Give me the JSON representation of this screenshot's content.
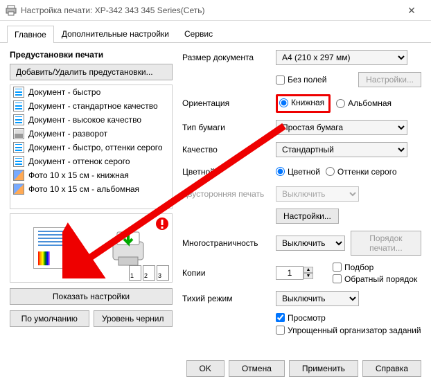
{
  "window": {
    "title": "Настройка печати: XP-342 343 345 Series(Сеть)"
  },
  "tabs": {
    "main": "Главное",
    "additional": "Дополнительные настройки",
    "service": "Сервис"
  },
  "left": {
    "sectionTitle": "Предустановки печати",
    "addRemoveBtn": "Добавить/Удалить предустановки...",
    "presets": [
      "Документ - быстро",
      "Документ - стандартное качество",
      "Документ - высокое качество",
      "Документ - разворот",
      "Документ - быстро, оттенки серого",
      "Документ - оттенок серого",
      "Фото 10 x 15 см - книжная",
      "Фото 10 x 15 см - альбомная"
    ],
    "showSettings": "Показать настройки",
    "defaultBtn": "По умолчанию",
    "inkLevels": "Уровень чернил"
  },
  "right": {
    "docSizeLabel": "Размер документа",
    "docSize": "A4 (210 x 297 мм)",
    "borderlessLabel": "Без полей",
    "settingsBtn": "Настройки...",
    "orientationLabel": "Ориентация",
    "portrait": "Книжная",
    "landscape": "Альбомная",
    "paperTypeLabel": "Тип бумаги",
    "paperType": "Простая бумага",
    "qualityLabel": "Качество",
    "quality": "Стандартный",
    "colorLabel": "Цветной",
    "colorRadio": "Цветной",
    "grayRadio": "Оттенки серого",
    "duplexLabel": "Двусторонняя печать",
    "duplex": "Выключить",
    "duplexSettings": "Настройки...",
    "multipageLabel": "Многостраничность",
    "multipage": "Выключить",
    "pageOrder": "Порядок печати...",
    "copiesLabel": "Копии",
    "copiesValue": "1",
    "collate": "Подбор",
    "reverse": "Обратный порядок",
    "quietLabel": "Тихий режим",
    "quiet": "Выключить",
    "preview": "Просмотр",
    "simplified": "Упрощенный организатор заданий"
  },
  "footer": {
    "ok": "OK",
    "cancel": "Отмена",
    "apply": "Применить",
    "help": "Справка"
  }
}
